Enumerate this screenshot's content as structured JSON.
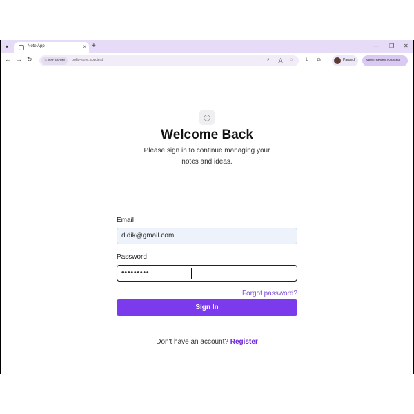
{
  "browser": {
    "tab_title": "Note App",
    "tab_close": "×",
    "new_tab": "+",
    "tab_menu": "▾",
    "window_controls": {
      "minimize": "—",
      "maximize": "❐",
      "close": "✕"
    },
    "nav": {
      "back": "←",
      "forward": "→",
      "reload": "↻"
    },
    "security_badge": "Not secure",
    "url": "polip-note.app.test",
    "profile_label": "Paused",
    "update_label": "New Chrome available"
  },
  "icons": {
    "menu": "chevron-down-icon",
    "favicon": "globe-icon",
    "security": "warning-icon",
    "lens": "lens-icon",
    "translate": "translate-icon",
    "bookmark": "star-icon",
    "extensions": "puzzle-icon",
    "download": "download-icon",
    "app_logo": "note-logo-icon"
  },
  "page": {
    "logo_glyph": "◎",
    "heading": "Welcome Back",
    "subtitle": "Please sign in to continue managing your notes and ideas.",
    "email_label": "Email",
    "email_value": "didik@gmail.com",
    "password_label": "Password",
    "password_value": "•••••••••",
    "forgot_link": "Forgot password?",
    "signin_button": "Sign In",
    "no_account_text": "Don't have an account?",
    "register_link": "Register"
  },
  "colors": {
    "accent": "#7c3aed",
    "link": "#7c4fd6",
    "tabstrip": "#e6dcf7"
  }
}
